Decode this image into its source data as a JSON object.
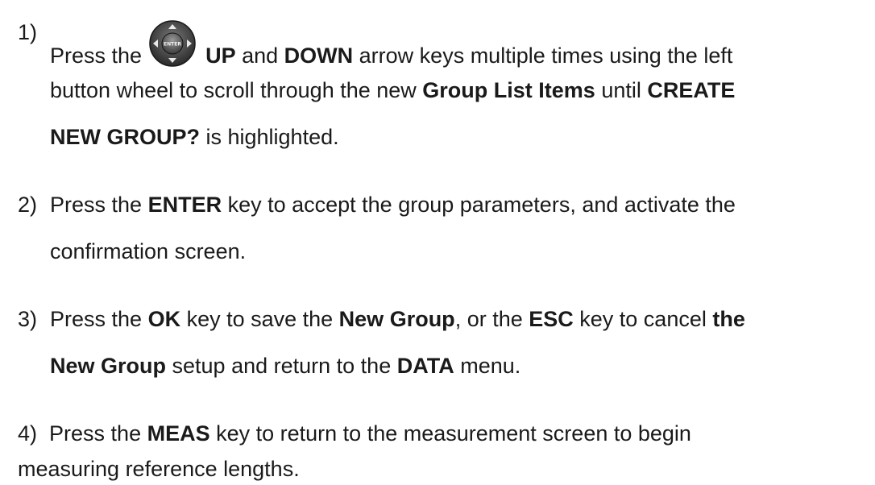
{
  "steps": [
    {
      "number": "1)",
      "lines": [
        {
          "pre": "Press the",
          "icon": "enter-wheel-icon",
          "icon_label": "ENTER",
          "b1": "UP",
          "t1": " and ",
          "b2": "DOWN",
          "t2": " arrow keys multiple times using the left"
        },
        {
          "t1": "button wheel to scroll through the new ",
          "b1": "Group List Items",
          "t2": " until ",
          "b2": "CREATE"
        },
        {
          "b1": "NEW GROUP?",
          "t1": " is highlighted."
        }
      ]
    },
    {
      "number": "2)",
      "lines": [
        {
          "t1": "Press the ",
          "b1": "ENTER",
          "t2": " key to accept the group parameters, and activate the"
        },
        {
          "t1": "confirmation screen."
        }
      ]
    },
    {
      "number": "3)",
      "lines": [
        {
          "t1": "Press the ",
          "b1": "OK",
          "t2": " key to save the ",
          "b2": "New Group",
          "t3": ", or the ",
          "b3": "ESC",
          "t4": " key to cancel ",
          "b4": "the"
        },
        {
          "b1": "New Group",
          "t1": " setup and return to the ",
          "b2": "DATA",
          "t2": " menu."
        }
      ]
    },
    {
      "number": "4)",
      "lines": [
        {
          "t1": "Press the ",
          "b1": "MEAS",
          "t2": " key to return to the measurement screen to begin"
        },
        {
          "t1": "measuring reference lengths."
        }
      ]
    }
  ]
}
